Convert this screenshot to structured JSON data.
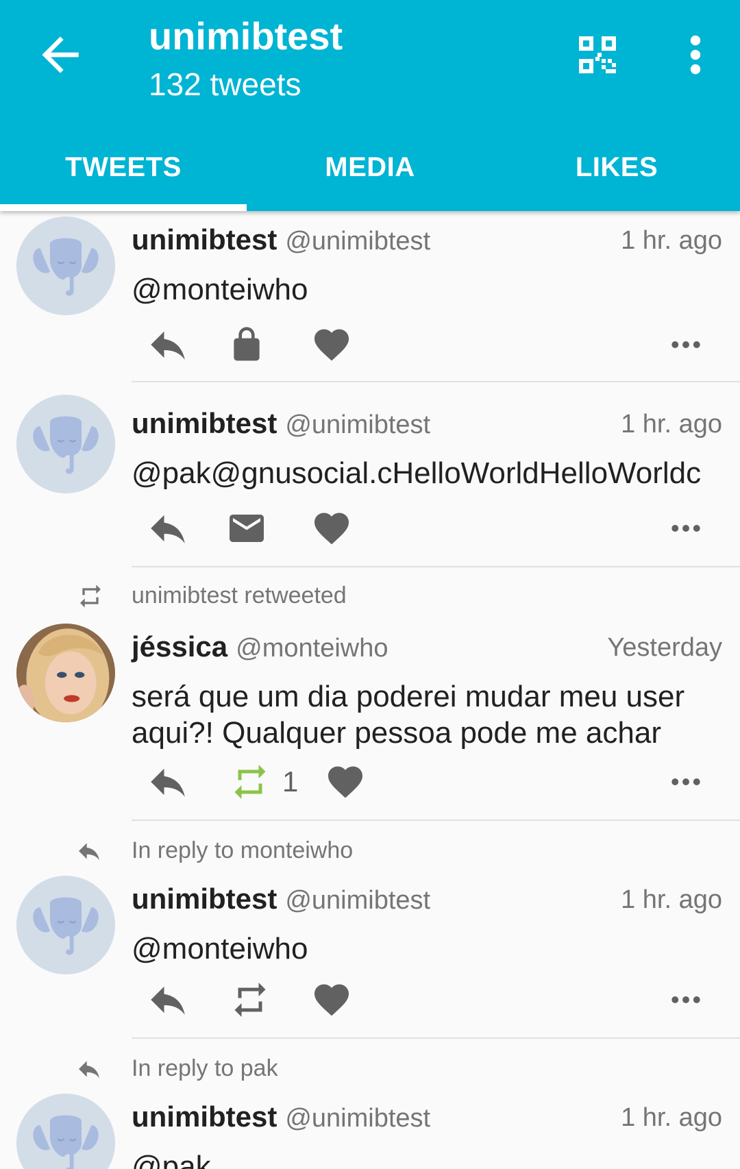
{
  "header": {
    "title": "unimibtest",
    "subtitle": "132 tweets",
    "tabs": [
      {
        "label": "TWEETS",
        "active": true
      },
      {
        "label": "MEDIA",
        "active": false
      },
      {
        "label": "LIKES",
        "active": false
      }
    ],
    "accent_color": "#00b4d3"
  },
  "tweets": [
    {
      "name": "unimibtest",
      "handle": "@unimibtest",
      "time": "1 hr. ago",
      "text": "@monteiwho",
      "second_action": "lock-icon"
    },
    {
      "name": "unimibtest",
      "handle": "@unimibtest",
      "time": "1 hr. ago",
      "text": "@pak@gnusocial.cHelloWorldHelloWorldc",
      "second_action": "mail-icon"
    },
    {
      "context": "unimibtest retweeted",
      "name": "jéssica",
      "handle": "@monteiwho",
      "time": "Yesterday",
      "text": "será que um dia poderei mudar meu user aqui?! Qualquer pessoa pode me achar",
      "retweet_count": "1",
      "retweet_color": "#8bc34a"
    },
    {
      "context": "In reply to monteiwho",
      "name": "unimibtest",
      "handle": "@unimibtest",
      "time": "1 hr. ago",
      "text": "@monteiwho"
    },
    {
      "context": "In reply to pak",
      "name": "unimibtest",
      "handle": "@unimibtest",
      "time": "1 hr. ago",
      "text": "@pak"
    }
  ]
}
